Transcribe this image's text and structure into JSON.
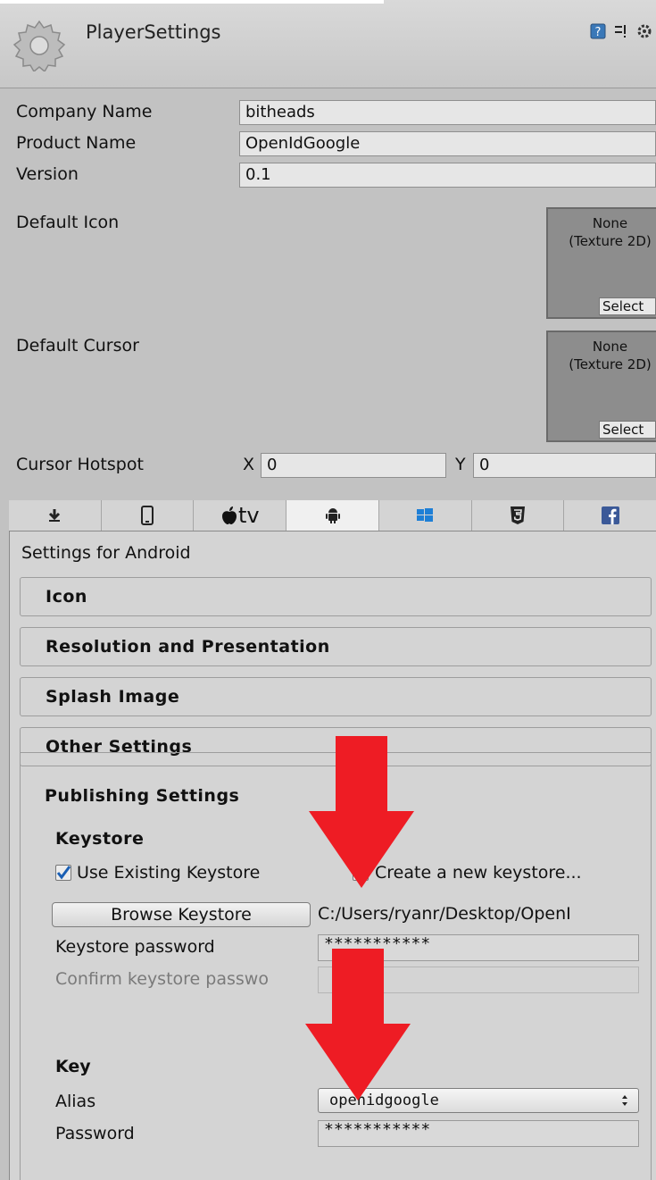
{
  "header": {
    "title": "PlayerSettings",
    "icons": [
      "help-icon",
      "settings-sliders-icon",
      "gear-icon"
    ]
  },
  "fields": {
    "company_name_label": "Company Name",
    "company_name_value": "bitheads",
    "product_name_label": "Product Name",
    "product_name_value": "OpenIdGoogle",
    "version_label": "Version",
    "version_value": "0.1"
  },
  "default_icon": {
    "label": "Default Icon",
    "value": "None (Texture 2D)",
    "select_label": "Select"
  },
  "default_cursor": {
    "label": "Default Cursor",
    "value": "None (Texture 2D)",
    "select_label": "Select"
  },
  "cursor_hotspot": {
    "label": "Cursor Hotspot",
    "x_label": "X",
    "x_value": "0",
    "y_label": "Y",
    "y_value": "0"
  },
  "platform_tabs": [
    {
      "icon": "download-icon",
      "text": ""
    },
    {
      "icon": "phone-icon",
      "text": ""
    },
    {
      "icon": "apple-icon",
      "text": "tv"
    },
    {
      "icon": "android-icon",
      "text": "",
      "active": true
    },
    {
      "icon": "windows-icon",
      "text": ""
    },
    {
      "icon": "html5-icon",
      "text": ""
    },
    {
      "icon": "facebook-icon",
      "text": ""
    }
  ],
  "settings_for": "Settings for Android",
  "sections": {
    "icon": "Icon",
    "resolution": "Resolution and Presentation",
    "splash": "Splash Image",
    "other": "Other Settings",
    "publishing": "Publishing Settings"
  },
  "keystore": {
    "heading": "Keystore",
    "use_existing_label": "Use Existing Keystore",
    "use_existing_checked": true,
    "create_new_label": "Create a new keystore...",
    "create_new_checked": false,
    "browse_button": "Browse Keystore",
    "path": "C:/Users/ryanr/Desktop/OpenI",
    "password_label": "Keystore password",
    "password_value": "***********",
    "confirm_label": "Confirm keystore passwo",
    "confirm_value": ""
  },
  "key": {
    "heading": "Key",
    "alias_label": "Alias",
    "alias_value": "openidgoogle",
    "password_label": "Password",
    "password_value": "***********"
  },
  "colors": {
    "background": "#c2c2c2",
    "panel": "#d4d4d4",
    "annotation_arrow": "#ee1c24",
    "checkbox_check": "#1a5fb4"
  }
}
